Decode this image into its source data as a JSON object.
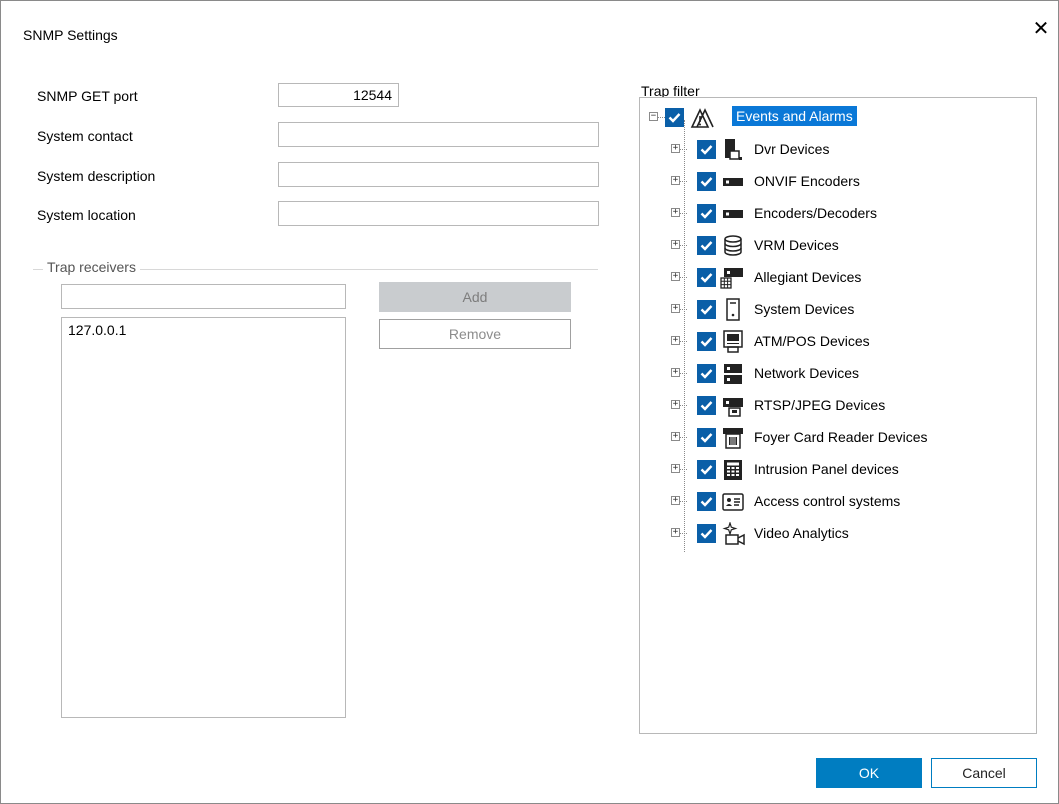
{
  "window": {
    "title": "SNMP Settings",
    "close_glyph": "✕"
  },
  "form": {
    "get_port_label": "SNMP GET port",
    "get_port_value": "12544",
    "contact_label": "System contact",
    "contact_value": "",
    "description_label": "System description",
    "description_value": "",
    "location_label": "System location",
    "location_value": ""
  },
  "trap_receivers": {
    "group_label": "Trap receivers",
    "input_value": "",
    "items": [
      "127.0.0.1"
    ],
    "add_label": "Add",
    "remove_label": "Remove"
  },
  "trap_filter": {
    "label": "Trap filter",
    "root": {
      "label": "Events and Alarms",
      "checked": true,
      "expanded": true,
      "icon": "events-alarms-icon"
    },
    "children": [
      {
        "label": "Dvr Devices",
        "icon": "dvr-icon",
        "checked": true
      },
      {
        "label": "ONVIF Encoders",
        "icon": "encoder-icon",
        "checked": true
      },
      {
        "label": "Encoders/Decoders",
        "icon": "encoder-icon",
        "checked": true
      },
      {
        "label": "VRM Devices",
        "icon": "vrm-icon",
        "checked": true
      },
      {
        "label": "Allegiant Devices",
        "icon": "allegiant-icon",
        "checked": true
      },
      {
        "label": "System Devices",
        "icon": "system-device-icon",
        "checked": true
      },
      {
        "label": "ATM/POS Devices",
        "icon": "atm-pos-icon",
        "checked": true
      },
      {
        "label": "Network Devices",
        "icon": "network-device-icon",
        "checked": true
      },
      {
        "label": "RTSP/JPEG Devices",
        "icon": "rtsp-jpeg-icon",
        "checked": true
      },
      {
        "label": "Foyer Card Reader Devices",
        "icon": "card-reader-icon",
        "checked": true
      },
      {
        "label": "Intrusion Panel devices",
        "icon": "intrusion-panel-icon",
        "checked": true
      },
      {
        "label": "Access control systems",
        "icon": "access-control-icon",
        "checked": true
      },
      {
        "label": "Video Analytics",
        "icon": "video-analytics-icon",
        "checked": true
      }
    ]
  },
  "footer": {
    "ok_label": "OK",
    "cancel_label": "Cancel"
  },
  "colors": {
    "accent": "#007dc1",
    "checkbox": "#0a5fa8",
    "selection": "#0a78d7"
  }
}
